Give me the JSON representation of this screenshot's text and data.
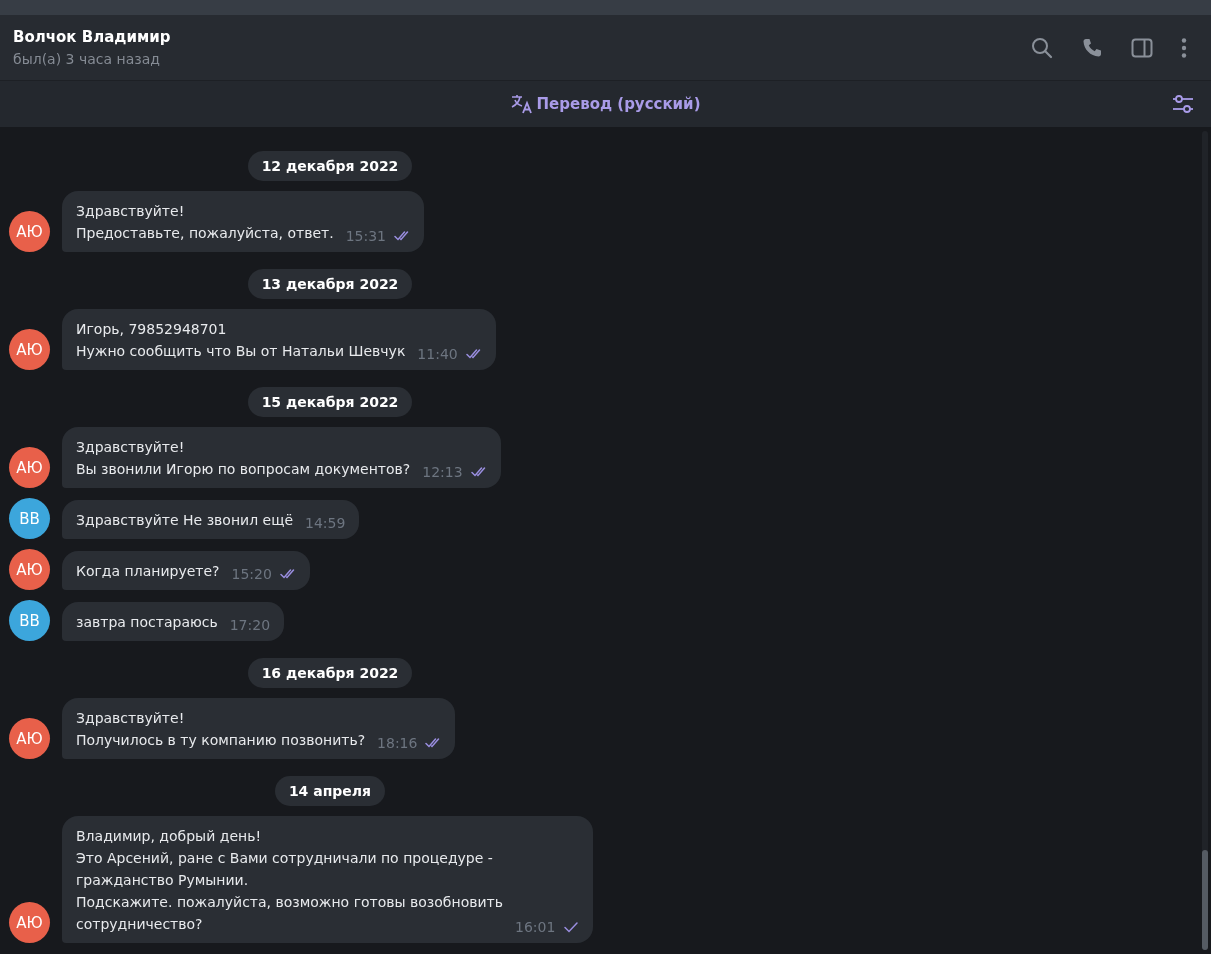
{
  "header": {
    "name": "Волчок Владимир",
    "status": "был(а) 3 часа назад"
  },
  "translate_bar": {
    "label": "Перевод (русский)"
  },
  "messages": [
    {
      "kind": "date",
      "text": "12 декабря 2022"
    },
    {
      "kind": "message",
      "initials": "АЮ",
      "color": "#e8604a",
      "lines": [
        "Здравствуйте!",
        "Предоставьте, пожалуйста, ответ."
      ],
      "time": "15:31",
      "outgoing": true,
      "read": true
    },
    {
      "kind": "date",
      "text": "13 декабря 2022"
    },
    {
      "kind": "message",
      "initials": "АЮ",
      "color": "#e8604a",
      "lines": [
        "Игорь, 79852948701",
        "Нужно сообщить что Вы от Натальи Шевчук"
      ],
      "time": "11:40",
      "outgoing": true,
      "read": true
    },
    {
      "kind": "date",
      "text": "15 декабря 2022"
    },
    {
      "kind": "message",
      "initials": "АЮ",
      "color": "#e8604a",
      "lines": [
        "Здравствуйте!",
        "Вы звонили Игорю по вопросам документов?"
      ],
      "time": "12:13",
      "outgoing": true,
      "read": true
    },
    {
      "kind": "message",
      "initials": "ВВ",
      "color": "#3ca6dc",
      "lines": [
        "Здравствуйте Не звонил ещё"
      ],
      "time": "14:59",
      "outgoing": false
    },
    {
      "kind": "message",
      "initials": "АЮ",
      "color": "#e8604a",
      "lines": [
        "Когда планируете?"
      ],
      "time": "15:20",
      "outgoing": true,
      "read": true
    },
    {
      "kind": "message",
      "initials": "ВВ",
      "color": "#3ca6dc",
      "lines": [
        "завтра постараюсь"
      ],
      "time": "17:20",
      "outgoing": false
    },
    {
      "kind": "date",
      "text": "16 декабря 2022"
    },
    {
      "kind": "message",
      "initials": "АЮ",
      "color": "#e8604a",
      "lines": [
        "Здравствуйте!",
        "Получилось в ту компанию позвонить?"
      ],
      "time": "18:16",
      "outgoing": true,
      "read": true
    },
    {
      "kind": "date",
      "text": "14 апреля"
    },
    {
      "kind": "message",
      "initials": "АЮ",
      "color": "#e8604a",
      "lines": [
        "Владимир, добрый день!",
        "Это Арсений, ране с Вами сотрудничали по процедуре -",
        "гражданство Румынии.",
        "Подскажите. пожалуйста, возможно готовы возобновить",
        "сотрудничество?"
      ],
      "time": "16:01",
      "outgoing": true,
      "read": false
    }
  ]
}
